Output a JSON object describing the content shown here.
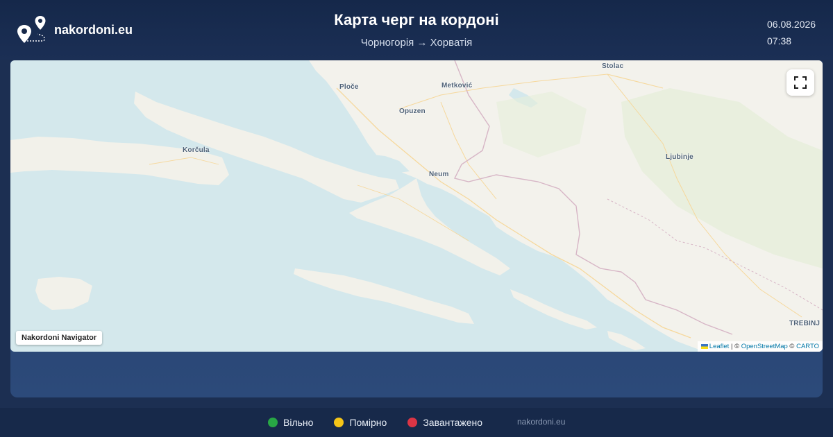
{
  "site": {
    "name": "nakordoni.eu"
  },
  "header": {
    "title": "Карта черг на кордоні",
    "route": "Чорногорія → Хорватія",
    "date": "06.08.2026",
    "time": "07:38"
  },
  "map": {
    "places": [
      {
        "id": "ploce",
        "label": "Ploče"
      },
      {
        "id": "metkovic",
        "label": "Metković"
      },
      {
        "id": "stolac",
        "label": "Stolac"
      },
      {
        "id": "opuzen",
        "label": "Opuzen"
      },
      {
        "id": "korcula",
        "label": "Korčula"
      },
      {
        "id": "neum",
        "label": "Neum"
      },
      {
        "id": "ljubinje",
        "label": "Ljubinje"
      },
      {
        "id": "trebinje",
        "label": "TREBINJ"
      }
    ],
    "badge": "Nakordoni Navigator",
    "attribution": {
      "leaflet": "Leaflet",
      "sep1": " | © ",
      "osm": "OpenStreetMap",
      "sep2": " © ",
      "carto": "CARTO"
    },
    "fullscreen_icon": "fullscreen-icon"
  },
  "legend": [
    {
      "label": "Вільно",
      "color": "#28a745"
    },
    {
      "label": "Помірно",
      "color": "#f5c518"
    },
    {
      "label": "Завантажено",
      "color": "#dc3545"
    }
  ],
  "footer": {
    "site": "nakordoni.eu"
  }
}
